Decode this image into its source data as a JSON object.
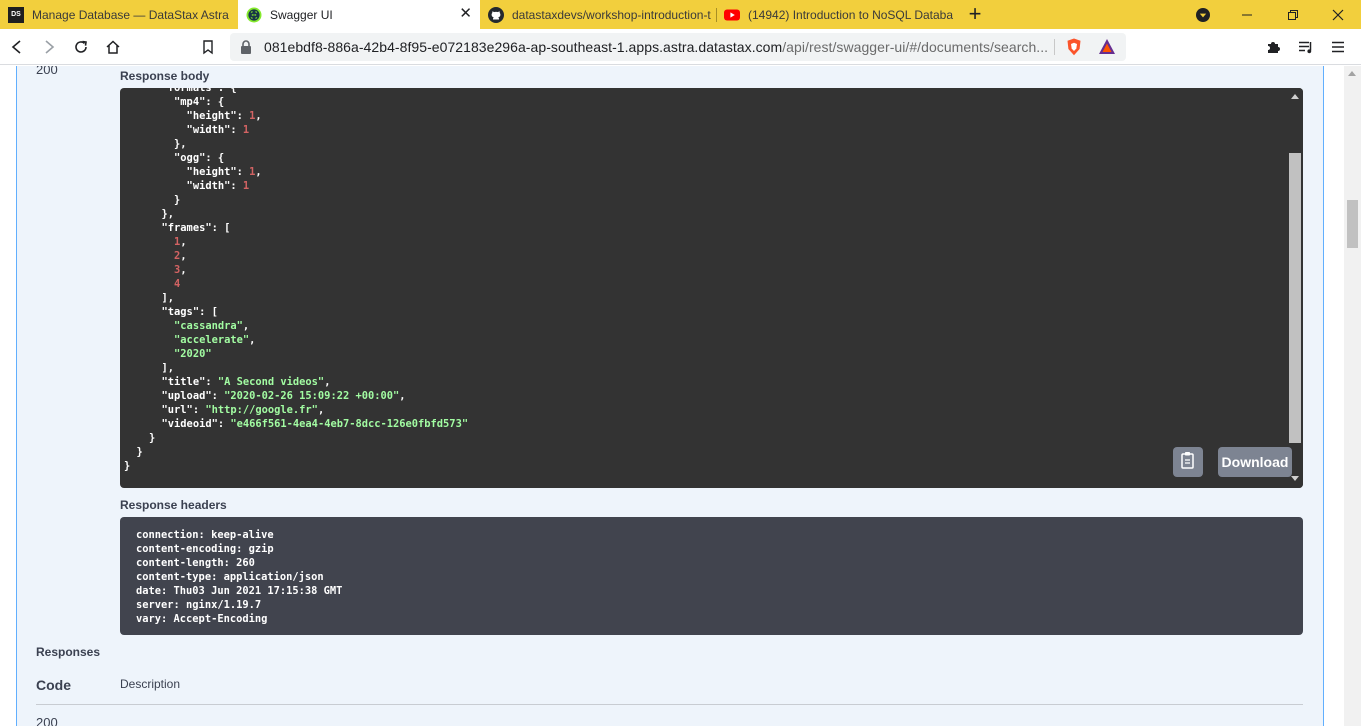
{
  "browser": {
    "tabs": [
      {
        "label": "Manage Database — DataStax Astra",
        "favicon": "datastax-logo-icon",
        "favicon_text": "DS"
      },
      {
        "label": "Swagger UI",
        "favicon": "swagger-logo-icon",
        "active": true
      },
      {
        "label": "datastaxdevs/workshop-introduction-t",
        "favicon": "github-logo-icon"
      },
      {
        "label": "(14942) Introduction to NoSQL Databa",
        "favicon": "youtube-logo-icon"
      }
    ],
    "address": {
      "host": "081ebdf8-886a-42b4-8f95-e072183e296a-ap-southeast-1.apps.astra.datastax.com",
      "path": "/api/rest/swagger-ui/#/documents/search..."
    }
  },
  "swagger": {
    "top_code": "200",
    "response_body_label": "Response body",
    "response_body_lines": [
      [
        {
          "t": "      \"formats\": {",
          "c": "p"
        }
      ],
      [
        {
          "t": "        \"mp4\": {",
          "c": "p"
        }
      ],
      [
        {
          "t": "          \"height\": ",
          "c": "p"
        },
        {
          "t": "1",
          "c": "num"
        },
        {
          "t": ",",
          "c": "p"
        }
      ],
      [
        {
          "t": "          \"width\": ",
          "c": "p"
        },
        {
          "t": "1",
          "c": "num"
        }
      ],
      [
        {
          "t": "        },",
          "c": "p"
        }
      ],
      [
        {
          "t": "        \"ogg\": {",
          "c": "p"
        }
      ],
      [
        {
          "t": "          \"height\": ",
          "c": "p"
        },
        {
          "t": "1",
          "c": "num"
        },
        {
          "t": ",",
          "c": "p"
        }
      ],
      [
        {
          "t": "          \"width\": ",
          "c": "p"
        },
        {
          "t": "1",
          "c": "num"
        }
      ],
      [
        {
          "t": "        }",
          "c": "p"
        }
      ],
      [
        {
          "t": "      },",
          "c": "p"
        }
      ],
      [
        {
          "t": "      \"frames\": [",
          "c": "p"
        }
      ],
      [
        {
          "t": "        ",
          "c": "p"
        },
        {
          "t": "1",
          "c": "num"
        },
        {
          "t": ",",
          "c": "p"
        }
      ],
      [
        {
          "t": "        ",
          "c": "p"
        },
        {
          "t": "2",
          "c": "num"
        },
        {
          "t": ",",
          "c": "p"
        }
      ],
      [
        {
          "t": "        ",
          "c": "p"
        },
        {
          "t": "3",
          "c": "num"
        },
        {
          "t": ",",
          "c": "p"
        }
      ],
      [
        {
          "t": "        ",
          "c": "p"
        },
        {
          "t": "4",
          "c": "num"
        }
      ],
      [
        {
          "t": "      ],",
          "c": "p"
        }
      ],
      [
        {
          "t": "      \"tags\": [",
          "c": "p"
        }
      ],
      [
        {
          "t": "        ",
          "c": "p"
        },
        {
          "t": "\"cassandra\"",
          "c": "str"
        },
        {
          "t": ",",
          "c": "p"
        }
      ],
      [
        {
          "t": "        ",
          "c": "p"
        },
        {
          "t": "\"accelerate\"",
          "c": "str"
        },
        {
          "t": ",",
          "c": "p"
        }
      ],
      [
        {
          "t": "        ",
          "c": "p"
        },
        {
          "t": "\"2020\"",
          "c": "str"
        }
      ],
      [
        {
          "t": "      ],",
          "c": "p"
        }
      ],
      [
        {
          "t": "      \"title\": ",
          "c": "p"
        },
        {
          "t": "\"A Second videos\"",
          "c": "str"
        },
        {
          "t": ",",
          "c": "p"
        }
      ],
      [
        {
          "t": "      \"upload\": ",
          "c": "p"
        },
        {
          "t": "\"2020-02-26 15:09:22 +00:00\"",
          "c": "str"
        },
        {
          "t": ",",
          "c": "p"
        }
      ],
      [
        {
          "t": "      \"url\": ",
          "c": "p"
        },
        {
          "t": "\"http://google.fr\"",
          "c": "str"
        },
        {
          "t": ",",
          "c": "p"
        }
      ],
      [
        {
          "t": "      \"videoid\": ",
          "c": "p"
        },
        {
          "t": "\"e466f561-4ea4-4eb7-8dcc-126e0fbfd573\"",
          "c": "str"
        }
      ],
      [
        {
          "t": "    }",
          "c": "p"
        }
      ],
      [
        {
          "t": "  }",
          "c": "p"
        }
      ],
      [
        {
          "t": "}",
          "c": "p"
        }
      ]
    ],
    "download_label": "Download",
    "response_headers_label": "Response headers",
    "response_headers_lines": [
      "connection: keep-alive",
      "content-encoding: gzip",
      "content-length: 260",
      "content-type: application/json",
      "date: Thu03 Jun 2021 17:15:38 GMT",
      "server: nginx/1.19.7",
      "vary: Accept-Encoding"
    ],
    "responses_title": "Responses",
    "col_code": "Code",
    "col_description": "Description",
    "bottom_code": "200"
  },
  "colors": {
    "tab_strip": "#f2cf3d",
    "code_bg": "#333333",
    "string": "#a2fca2",
    "number": "#d36363",
    "opblock_bg": "#eef4fb",
    "opblock_border": "#61affe"
  }
}
